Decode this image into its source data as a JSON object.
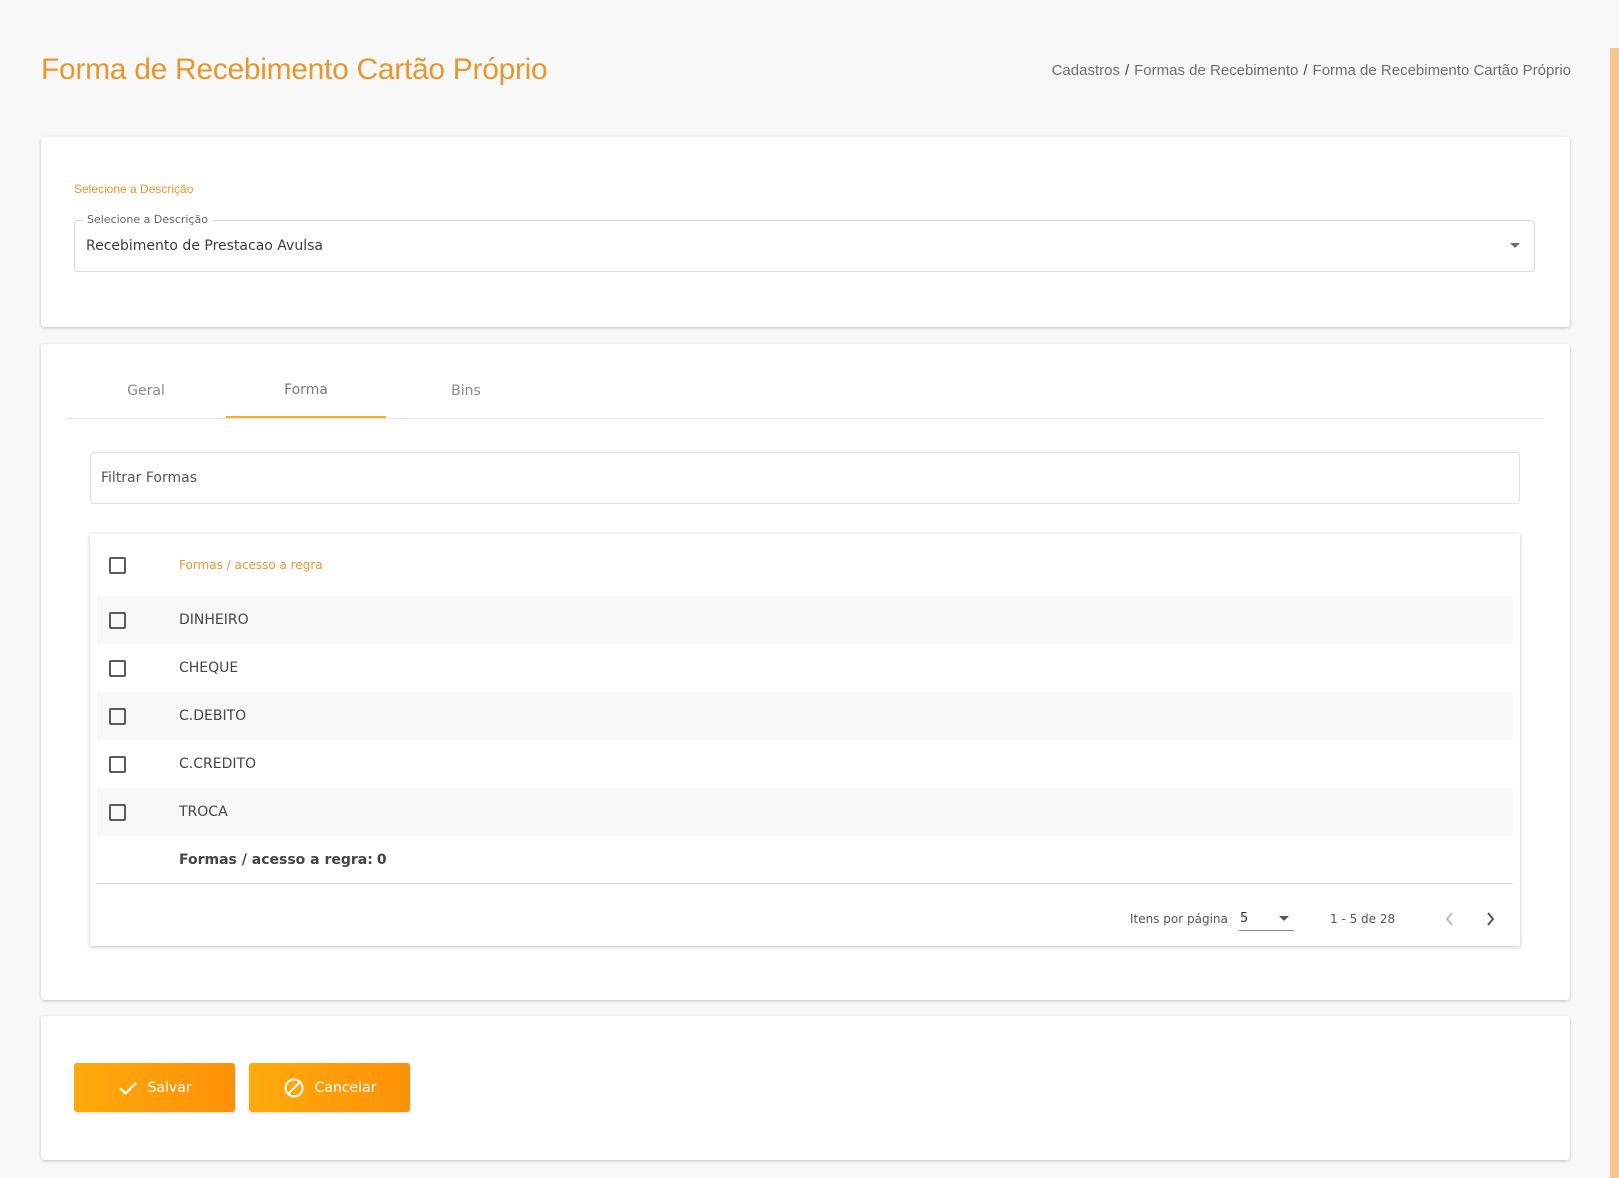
{
  "page": {
    "title": "Forma de Recebimento Cartão Próprio",
    "breadcrumb": [
      "Cadastros",
      "Formas de Recebimento",
      "Forma de Recebimento Cartão Próprio"
    ],
    "breadcrumb_separator": "/"
  },
  "description_card": {
    "section_label": "Selecione a Descrição",
    "select_label": "Selecione a Descrição",
    "select_value": "Recebimento de Prestacao Avulsa"
  },
  "tabs": [
    {
      "label": "Geral",
      "active": false
    },
    {
      "label": "Forma",
      "active": true
    },
    {
      "label": "Bins",
      "active": false
    }
  ],
  "filter": {
    "placeholder": "Filtrar Formas",
    "value": ""
  },
  "table": {
    "header": "Formas / acesso a regra",
    "rows": [
      "DINHEIRO",
      "CHEQUE",
      "C.DEBITO",
      "C.CREDITO",
      "TROCA"
    ],
    "footer_label": "Formas / acesso a regra:",
    "footer_count": "0"
  },
  "paginator": {
    "per_page_label": "Itens por página",
    "per_page_value": "5",
    "range_label": "1 - 5 de 28"
  },
  "actions": {
    "save_label": "Salvar",
    "cancel_label": "Cancelar"
  },
  "colors": {
    "accent": "#e8962e",
    "tab_indicator": "#f0b323",
    "button": "#fe9f0a"
  },
  "icons": {
    "save": "check-icon",
    "cancel": "block-icon",
    "prev": "chevron-left-icon",
    "next": "chevron-right-icon",
    "dropdown": "caret-down-icon"
  }
}
